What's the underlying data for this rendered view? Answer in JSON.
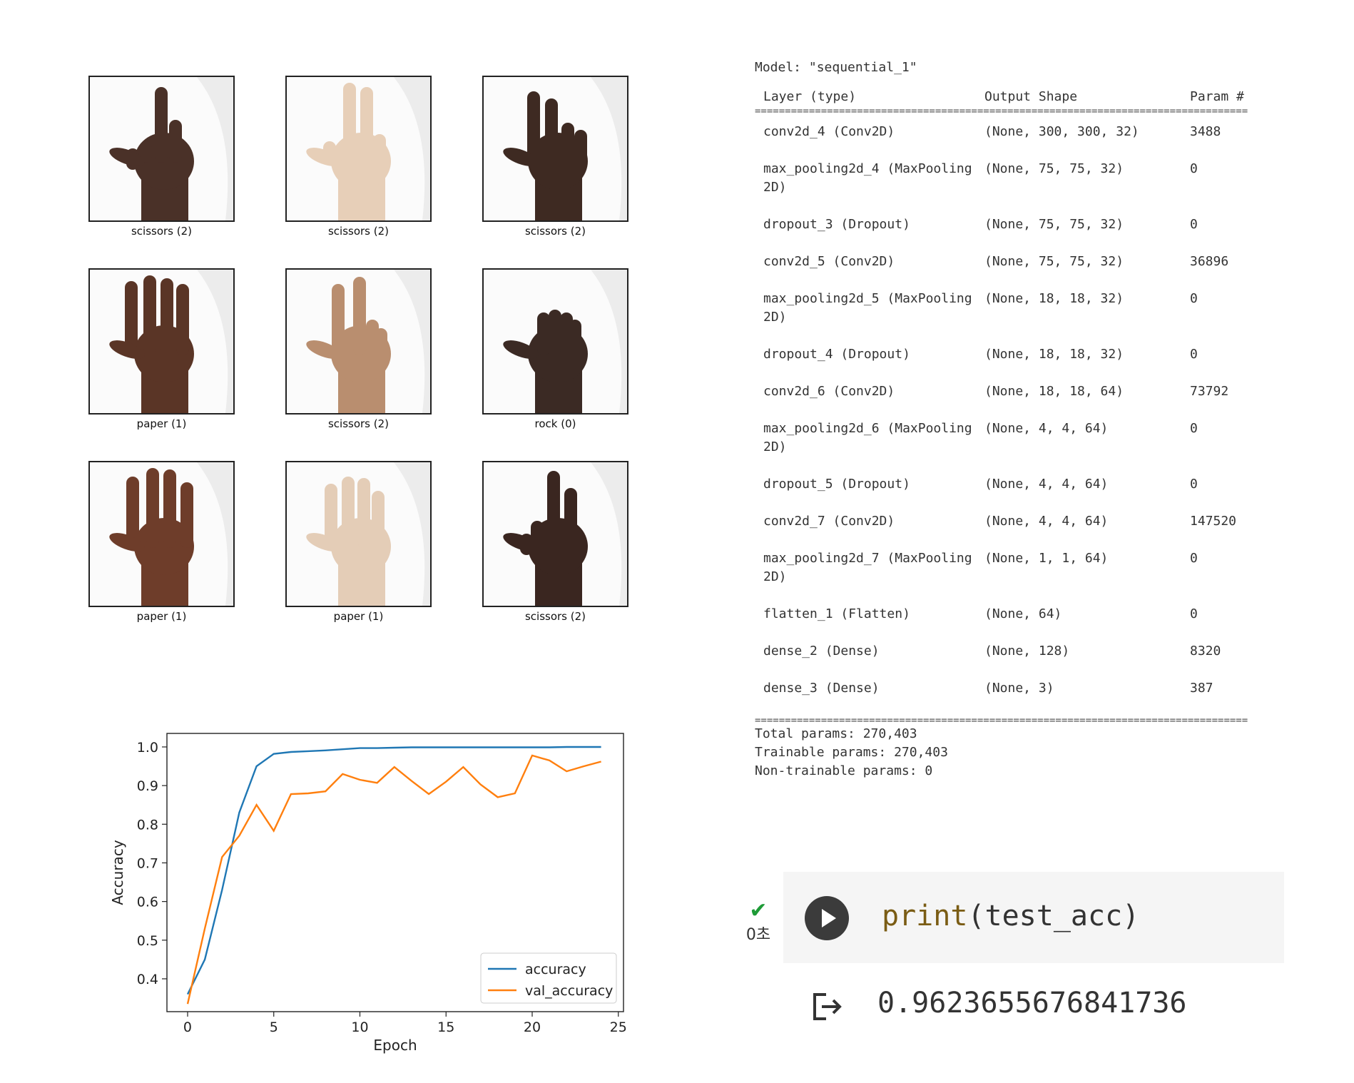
{
  "images": [
    {
      "label": "scissors (2)",
      "skin": "#4a3128",
      "gesture": "scissors-a"
    },
    {
      "label": "scissors (2)",
      "skin": "#e7cfb8",
      "gesture": "scissors-b"
    },
    {
      "label": "scissors (2)",
      "skin": "#3e2a22",
      "gesture": "scissors-c"
    },
    {
      "label": "paper (1)",
      "skin": "#5a3526",
      "gesture": "paper-a"
    },
    {
      "label": "scissors (2)",
      "skin": "#b98e6f",
      "gesture": "scissors-d"
    },
    {
      "label": "rock (0)",
      "skin": "#3b2a24",
      "gesture": "rock"
    },
    {
      "label": "paper (1)",
      "skin": "#6e3d2a",
      "gesture": "paper-b"
    },
    {
      "label": "paper (1)",
      "skin": "#e4cdb7",
      "gesture": "paper-c"
    },
    {
      "label": "scissors (2)",
      "skin": "#3a2620",
      "gesture": "scissors-e"
    }
  ],
  "chart_data": {
    "type": "line",
    "xlabel": "Epoch",
    "ylabel": "Accuracy",
    "xlim": [
      -1.2,
      25.3
    ],
    "ylim": [
      0.315,
      1.035
    ],
    "xticks": [
      0,
      5,
      10,
      15,
      20,
      25
    ],
    "yticks": [
      0.4,
      0.5,
      0.6,
      0.7,
      0.8,
      0.9,
      1.0
    ],
    "ytick_labels": [
      "0.4",
      "0.5",
      "0.6",
      "0.7",
      "0.8",
      "0.9",
      "1.0"
    ],
    "legend_position": "lower right",
    "grid": false,
    "x": [
      0,
      1,
      2,
      3,
      4,
      5,
      6,
      7,
      8,
      9,
      10,
      11,
      12,
      13,
      14,
      15,
      16,
      17,
      18,
      19,
      20,
      21,
      22,
      23,
      24
    ],
    "series": [
      {
        "name": "accuracy",
        "color": "#1f77b4",
        "values": [
          0.36,
          0.45,
          0.63,
          0.83,
          0.95,
          0.982,
          0.987,
          0.989,
          0.991,
          0.994,
          0.997,
          0.997,
          0.998,
          0.999,
          0.999,
          0.999,
          0.999,
          0.999,
          0.999,
          0.999,
          0.999,
          0.999,
          1.0,
          1.0,
          1.0
        ]
      },
      {
        "name": "val_accuracy",
        "color": "#ff7f0e",
        "values": [
          0.335,
          0.53,
          0.715,
          0.77,
          0.85,
          0.783,
          0.878,
          0.88,
          0.885,
          0.93,
          0.915,
          0.907,
          0.948,
          0.912,
          0.878,
          0.91,
          0.948,
          0.903,
          0.87,
          0.88,
          0.978,
          0.965,
          0.937,
          0.95,
          0.962
        ]
      }
    ]
  },
  "summary": {
    "model_line": "Model: \"sequential_1\"",
    "headers": {
      "layer": "Layer (type)",
      "shape": "Output Shape",
      "params": "Param #"
    },
    "rows": [
      {
        "layer": "conv2d_4 (Conv2D)",
        "shape": "(None, 300, 300, 32)",
        "params": "3488"
      },
      {
        "layer": "max_pooling2d_4 (MaxPooling\n2D)",
        "shape": "(None, 75, 75, 32)",
        "params": "0"
      },
      {
        "layer": "dropout_3 (Dropout)",
        "shape": "(None, 75, 75, 32)",
        "params": "0"
      },
      {
        "layer": "conv2d_5 (Conv2D)",
        "shape": "(None, 75, 75, 32)",
        "params": "36896"
      },
      {
        "layer": "max_pooling2d_5 (MaxPooling\n2D)",
        "shape": "(None, 18, 18, 32)",
        "params": "0"
      },
      {
        "layer": "dropout_4 (Dropout)",
        "shape": "(None, 18, 18, 32)",
        "params": "0"
      },
      {
        "layer": "conv2d_6 (Conv2D)",
        "shape": "(None, 18, 18, 64)",
        "params": "73792"
      },
      {
        "layer": "max_pooling2d_6 (MaxPooling\n2D)",
        "shape": "(None, 4, 4, 64)",
        "params": "0"
      },
      {
        "layer": "dropout_5 (Dropout)",
        "shape": "(None, 4, 4, 64)",
        "params": "0"
      },
      {
        "layer": "conv2d_7 (Conv2D)",
        "shape": "(None, 4, 4, 64)",
        "params": "147520"
      },
      {
        "layer": "max_pooling2d_7 (MaxPooling\n2D)",
        "shape": "(None, 1, 1, 64)",
        "params": "0"
      },
      {
        "layer": "flatten_1 (Flatten)",
        "shape": "(None, 64)",
        "params": "0"
      },
      {
        "layer": "dense_2 (Dense)",
        "shape": "(None, 128)",
        "params": "8320"
      },
      {
        "layer": "dense_3 (Dense)",
        "shape": "(None, 3)",
        "params": "387"
      }
    ],
    "total": "Total params: 270,403",
    "trainable": "Trainable params: 270,403",
    "non_trainable": "Non-trainable params: 0"
  },
  "cell": {
    "status_icon": "check-icon",
    "elapsed": "0초",
    "code_fn": "print",
    "code_args": "(test_acc)",
    "output": "0.9623655676841736"
  }
}
